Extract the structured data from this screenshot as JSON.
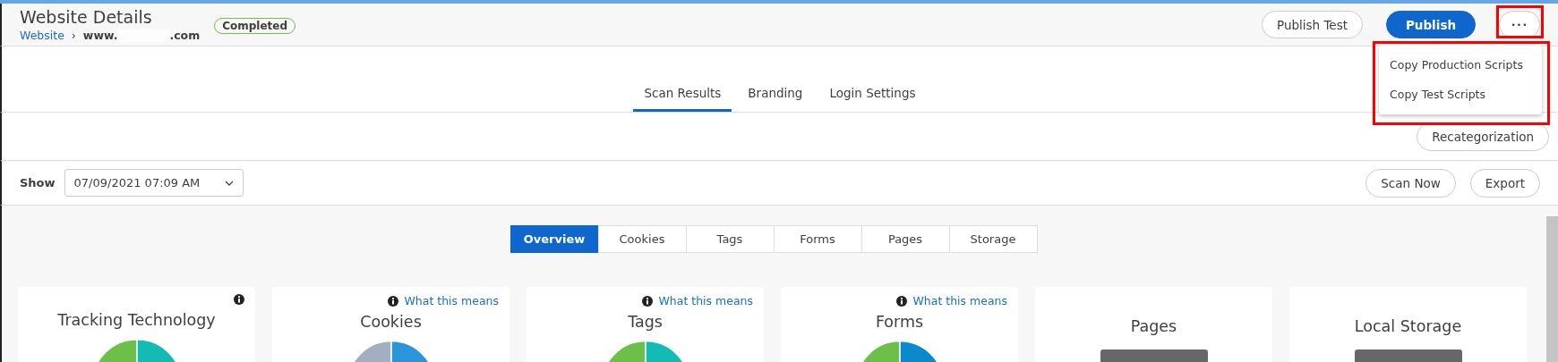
{
  "header": {
    "title": "Website Details",
    "breadcrumb": {
      "link": "Website",
      "separator": "›",
      "domain_start": "www.",
      "domain_end": ".com"
    },
    "status": "Completed",
    "buttons": [
      {
        "label": "Publish Test",
        "kind": "secondary"
      },
      {
        "label": "Publish",
        "kind": "primary"
      },
      {
        "label": "•••",
        "kind": "more"
      }
    ]
  },
  "menu": {
    "items": [
      "Copy Production Scripts",
      "Copy Test Scripts"
    ]
  },
  "tabs": [
    {
      "label": "Scan Results",
      "selected": true
    },
    {
      "label": "Branding",
      "selected": false
    },
    {
      "label": "Login Settings",
      "selected": false
    }
  ],
  "recategorize_button": "Recategorization",
  "filter": {
    "label": "Show",
    "value": "07/09/2021 07:09 AM"
  },
  "actions": [
    "Scan Now",
    "Export"
  ],
  "view_tabs": [
    {
      "label": "Overview",
      "selected": true
    },
    {
      "label": "Cookies",
      "selected": false
    },
    {
      "label": "Tags",
      "selected": false
    },
    {
      "label": "Forms",
      "selected": false
    },
    {
      "label": "Pages",
      "selected": false
    },
    {
      "label": "Storage",
      "selected": false
    }
  ],
  "cards": [
    {
      "title": "Tracking Technology",
      "info_icon": true,
      "kind": "pie",
      "segments": [
        {
          "color": "#6cc04a"
        },
        {
          "color": "#13bbb5"
        }
      ]
    },
    {
      "title": "Cookies",
      "info_icon": true,
      "help_link": "What this means",
      "kind": "pie",
      "segments": [
        {
          "color": "#a3afc0"
        },
        {
          "color": "#2a95d9"
        }
      ]
    },
    {
      "title": "Tags",
      "info_icon": true,
      "help_link": "What this means",
      "kind": "pie",
      "segments": [
        {
          "color": "#6cc04a"
        },
        {
          "color": "#13bbb5"
        }
      ]
    },
    {
      "title": "Forms",
      "info_icon": true,
      "help_link": "What this means",
      "kind": "pie",
      "segments": [
        {
          "color": "#6cc04a"
        },
        {
          "color": "#0a8acb"
        }
      ]
    },
    {
      "title": "Pages",
      "info_icon": false,
      "kind": "block"
    },
    {
      "title": "Local Storage",
      "info_icon": false,
      "kind": "block"
    }
  ]
}
